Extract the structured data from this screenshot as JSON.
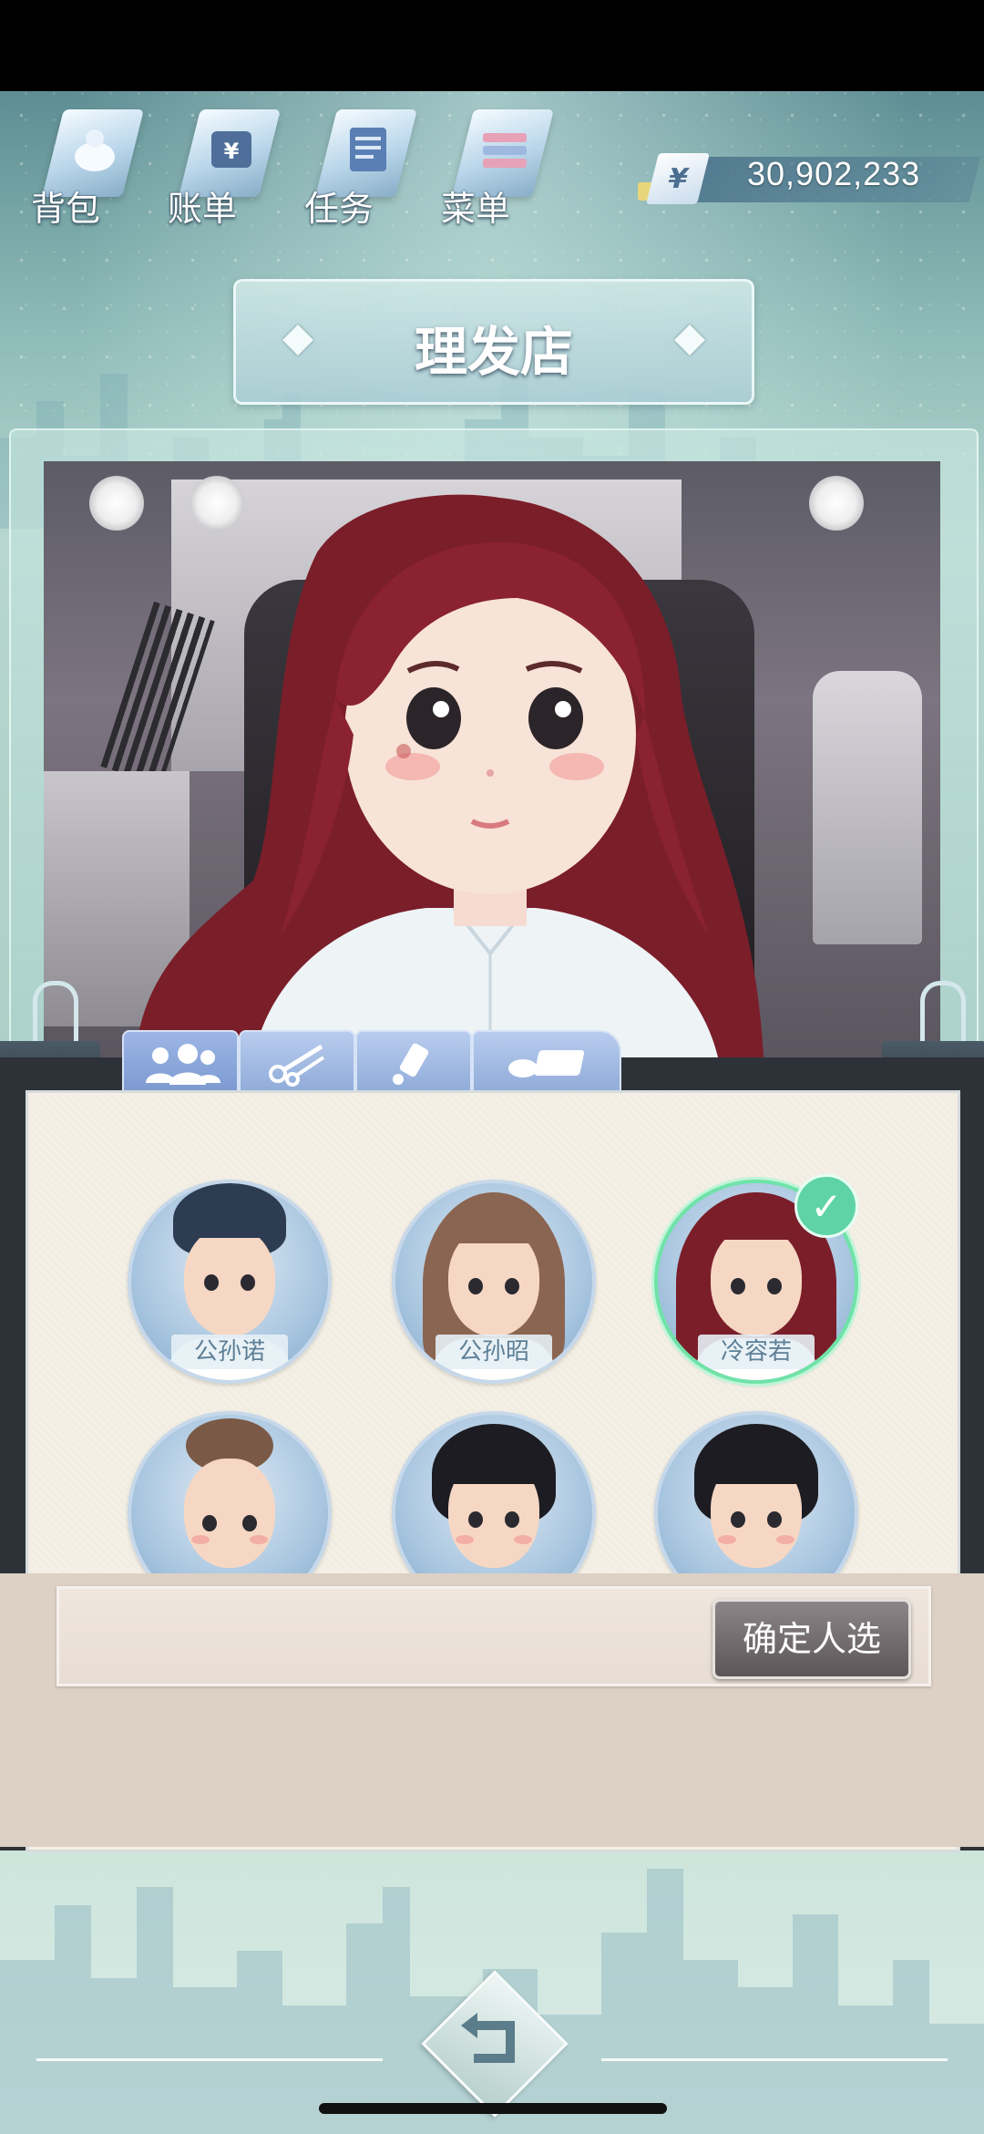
{
  "top_menu": {
    "items": [
      {
        "label": "背包",
        "icon": "bag-icon"
      },
      {
        "label": "账单",
        "icon": "bill-icon"
      },
      {
        "label": "任务",
        "icon": "task-icon"
      },
      {
        "label": "菜单",
        "icon": "menu-icon"
      }
    ],
    "currency_symbol": "¥",
    "money": "30,902,233"
  },
  "shop": {
    "title": "理发店"
  },
  "tabs": [
    {
      "icon": "people-icon",
      "active": true
    },
    {
      "icon": "scissors-icon",
      "active": false
    },
    {
      "icon": "dye-tube-icon",
      "active": false
    },
    {
      "icon": "makeup-icon",
      "active": false
    }
  ],
  "customers": [
    {
      "name": "公孙诺",
      "selected": false
    },
    {
      "name": "公孙昭",
      "selected": false
    },
    {
      "name": "冷容若",
      "selected": true
    },
    {
      "name": "",
      "selected": false
    },
    {
      "name": "",
      "selected": false
    },
    {
      "name": "",
      "selected": false
    }
  ],
  "confirm": {
    "label": "确定人选"
  },
  "colors": {
    "accent_tab": "#8eaad8",
    "selected_ring": "#6fe3a8",
    "hair_red": "#7a1e2a"
  }
}
